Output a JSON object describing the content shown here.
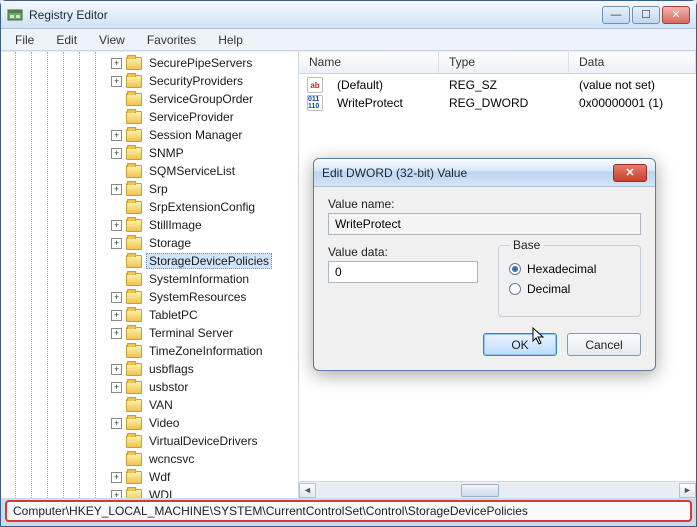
{
  "window": {
    "title": "Registry Editor"
  },
  "menubar": {
    "items": [
      "File",
      "Edit",
      "View",
      "Favorites",
      "Help"
    ]
  },
  "tree": {
    "items": [
      "SecurePipeServers",
      "SecurityProviders",
      "ServiceGroupOrder",
      "ServiceProvider",
      "Session Manager",
      "SNMP",
      "SQMServiceList",
      "Srp",
      "SrpExtensionConfig",
      "StillImage",
      "Storage",
      "StorageDevicePolicies",
      "SystemInformation",
      "SystemResources",
      "TabletPC",
      "Terminal Server",
      "TimeZoneInformation",
      "usbflags",
      "usbstor",
      "VAN",
      "Video",
      "VirtualDeviceDrivers",
      "wcncsvc",
      "Wdf",
      "WDI"
    ],
    "selected": "StorageDevicePolicies"
  },
  "list": {
    "headers": {
      "name": "Name",
      "type": "Type",
      "data": "Data"
    },
    "rows": [
      {
        "icon": "str",
        "name": "(Default)",
        "type": "REG_SZ",
        "data": "(value not set)"
      },
      {
        "icon": "bin",
        "name": "WriteProtect",
        "type": "REG_DWORD",
        "data": "0x00000001 (1)"
      }
    ]
  },
  "dialog": {
    "title": "Edit DWORD (32-bit) Value",
    "value_name_label": "Value name:",
    "value_name": "WriteProtect",
    "value_data_label": "Value data:",
    "value_data": "0",
    "base_label": "Base",
    "hex_label": "Hexadecimal",
    "dec_label": "Decimal",
    "ok": "OK",
    "cancel": "Cancel"
  },
  "statusbar": {
    "path": "Computer\\HKEY_LOCAL_MACHINE\\SYSTEM\\CurrentControlSet\\Control\\StorageDevicePolicies"
  }
}
